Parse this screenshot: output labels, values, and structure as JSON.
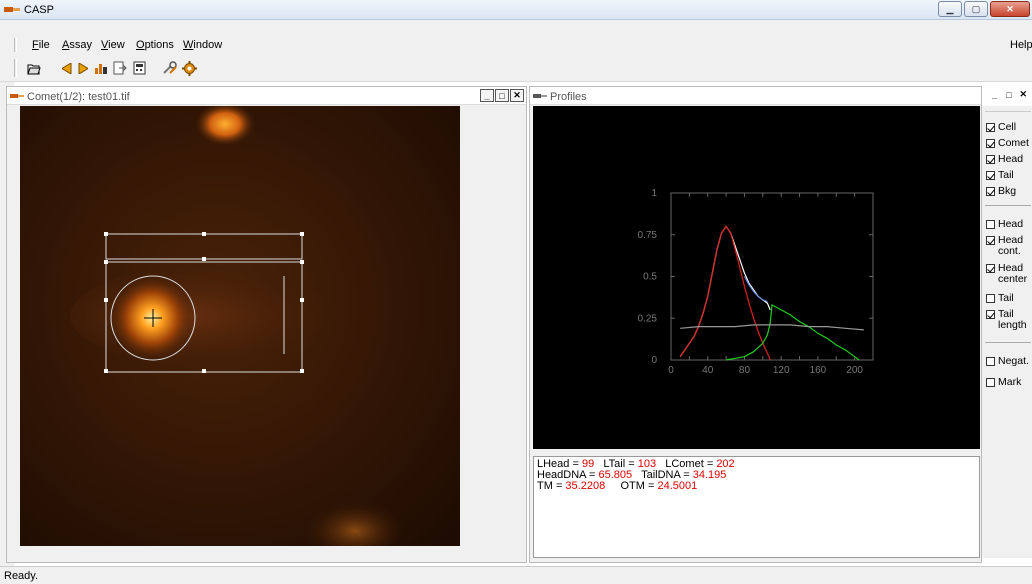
{
  "window": {
    "title": "CASP"
  },
  "menu": {
    "items": [
      {
        "label": "File",
        "key": "F",
        "rest": "ile"
      },
      {
        "label": "Assay",
        "key": "A",
        "rest": "ssay"
      },
      {
        "label": "View",
        "key": "V",
        "rest": "iew"
      },
      {
        "label": "Options",
        "key": "O",
        "rest": "ptions"
      },
      {
        "label": "Window",
        "key": "W",
        "rest": "indow"
      }
    ],
    "help": "Help"
  },
  "toolbar": {
    "icons": [
      "open-folder-icon",
      "arrow-left-icon",
      "arrow-right-icon",
      "chart-icon",
      "export-icon",
      "calculator-icon",
      "tools-icon",
      "gear-icon"
    ]
  },
  "comet_window": {
    "title": "Comet(1/2): test01.tif"
  },
  "profiles_window": {
    "title": "Profiles"
  },
  "chart_data": {
    "type": "line",
    "xlim": [
      0,
      220
    ],
    "ylim": [
      0,
      1
    ],
    "x_ticks": [
      "0",
      "40",
      "80",
      "120",
      "160",
      "200"
    ],
    "y_ticks": [
      "0",
      "0.25",
      "0.5",
      "0.75",
      "1"
    ],
    "series": [
      {
        "color": "#ffffff",
        "x": [
          10,
          15,
          20,
          25,
          30,
          35,
          40,
          45,
          50,
          55,
          60,
          65,
          70,
          75,
          80,
          85,
          90,
          95,
          100,
          105,
          108
        ],
        "y": [
          0.02,
          0.06,
          0.1,
          0.14,
          0.2,
          0.28,
          0.38,
          0.52,
          0.66,
          0.76,
          0.8,
          0.76,
          0.68,
          0.6,
          0.52,
          0.46,
          0.42,
          0.38,
          0.36,
          0.34,
          0.3
        ]
      },
      {
        "color": "#e02020",
        "x": [
          10,
          15,
          20,
          25,
          30,
          35,
          40,
          45,
          50,
          55,
          60,
          65,
          70,
          75,
          80,
          85,
          90,
          95,
          100,
          105,
          108
        ],
        "y": [
          0.02,
          0.06,
          0.1,
          0.14,
          0.2,
          0.28,
          0.38,
          0.52,
          0.66,
          0.76,
          0.8,
          0.76,
          0.66,
          0.55,
          0.44,
          0.34,
          0.25,
          0.17,
          0.1,
          0.04,
          0.0
        ]
      },
      {
        "color": "#20d020",
        "x": [
          60,
          70,
          80,
          90,
          100,
          105,
          108,
          110,
          120,
          130,
          140,
          150,
          160,
          170,
          180,
          190,
          200,
          205
        ],
        "y": [
          0.0,
          0.01,
          0.02,
          0.05,
          0.1,
          0.15,
          0.22,
          0.33,
          0.3,
          0.27,
          0.23,
          0.2,
          0.16,
          0.13,
          0.09,
          0.06,
          0.02,
          0.0
        ]
      },
      {
        "color": "#6688dd",
        "x": [
          80,
          85,
          90,
          95,
          100,
          105
        ],
        "y": [
          0.5,
          0.45,
          0.41,
          0.38,
          0.36,
          0.35
        ]
      },
      {
        "color": "#999999",
        "x": [
          10,
          30,
          50,
          70,
          90,
          110,
          130,
          150,
          170,
          190,
          210
        ],
        "y": [
          0.19,
          0.2,
          0.2,
          0.2,
          0.21,
          0.21,
          0.21,
          0.2,
          0.2,
          0.19,
          0.18
        ]
      }
    ],
    "grid": false
  },
  "results": {
    "lhead_label": "LHead = ",
    "lhead": "99",
    "ltail_label": "LTail = ",
    "ltail": "103",
    "lcomet_label": "LComet = ",
    "lcomet": "202",
    "headdna_label": "HeadDNA = ",
    "headdna": "65.805",
    "taildna_label": "TailDNA = ",
    "taildna": "34.195",
    "tm_label": "TM = ",
    "tm": "35.2208",
    "otm_label": "OTM = ",
    "otm": "24.5001"
  },
  "panel": {
    "checks": [
      {
        "label": "Cell",
        "checked": true
      },
      {
        "label": "Comet",
        "checked": true
      },
      {
        "label": "Head",
        "checked": true
      },
      {
        "label": "Tail",
        "checked": true
      },
      {
        "label": "Bkg",
        "checked": true
      },
      {
        "label": "Head",
        "checked": false
      },
      {
        "label": "Head cont.",
        "checked": true
      },
      {
        "label": "Head center",
        "checked": true
      },
      {
        "label": "Tail",
        "checked": false
      },
      {
        "label": "Tail length",
        "checked": true
      },
      {
        "label": "Negat.",
        "checked": false
      },
      {
        "label": "Mark",
        "checked": false
      }
    ]
  },
  "status": {
    "text": "Ready."
  }
}
